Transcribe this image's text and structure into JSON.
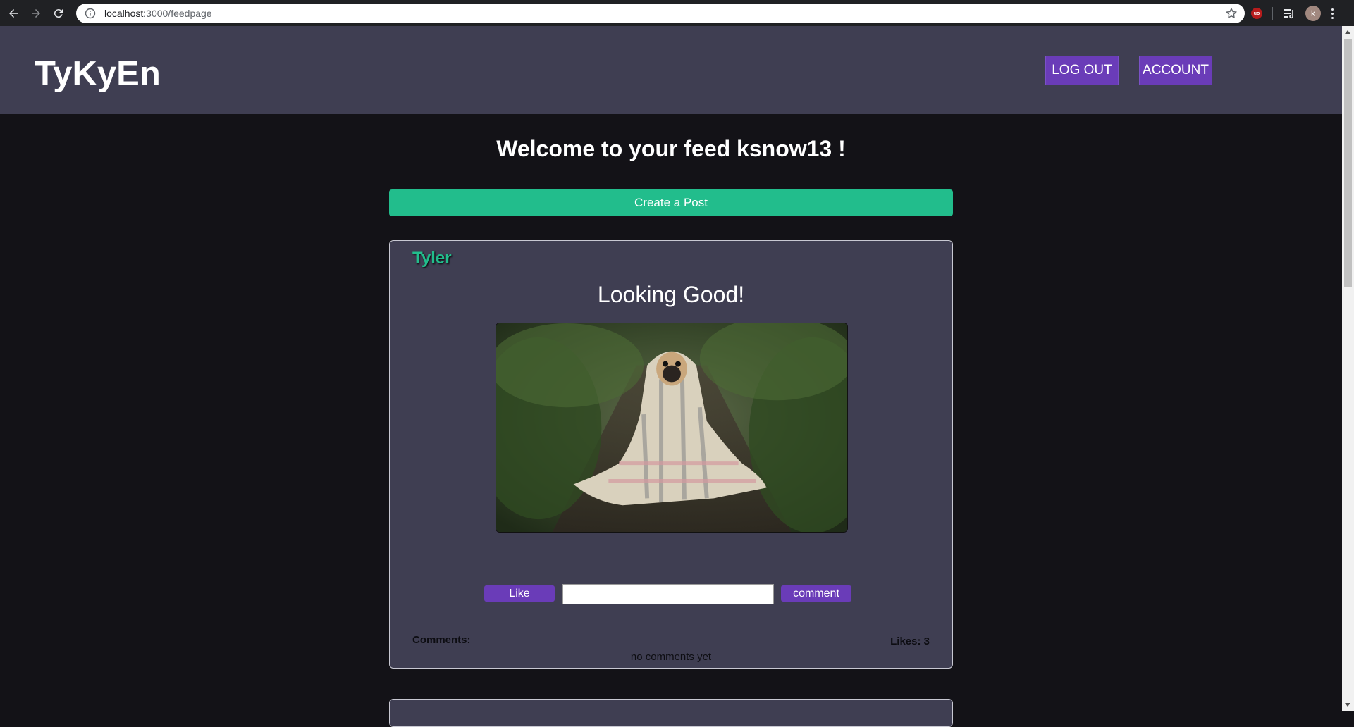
{
  "browser": {
    "url_host": "localhost",
    "url_path": ":3000/feedpage",
    "avatar_letter": "k",
    "extension_badge": "uo"
  },
  "header": {
    "brand": "TyKyEn",
    "logout_label": "LOG OUT",
    "account_label": "ACCOUNT"
  },
  "main": {
    "welcome": "Welcome to your feed ksnow13 !",
    "create_post_label": "Create a Post"
  },
  "post": {
    "author": "Tyler",
    "title": "Looking Good!",
    "like_label": "Like",
    "comment_label": "comment",
    "comment_value": "",
    "comments_heading": "Comments:",
    "likes_text": "Likes: 3",
    "no_comments_text": "no comments yet"
  },
  "colors": {
    "page_bg": "#131217",
    "header_bg": "#3f3e52",
    "accent_purple": "#6a3cb8",
    "accent_green": "#22bd8c"
  }
}
